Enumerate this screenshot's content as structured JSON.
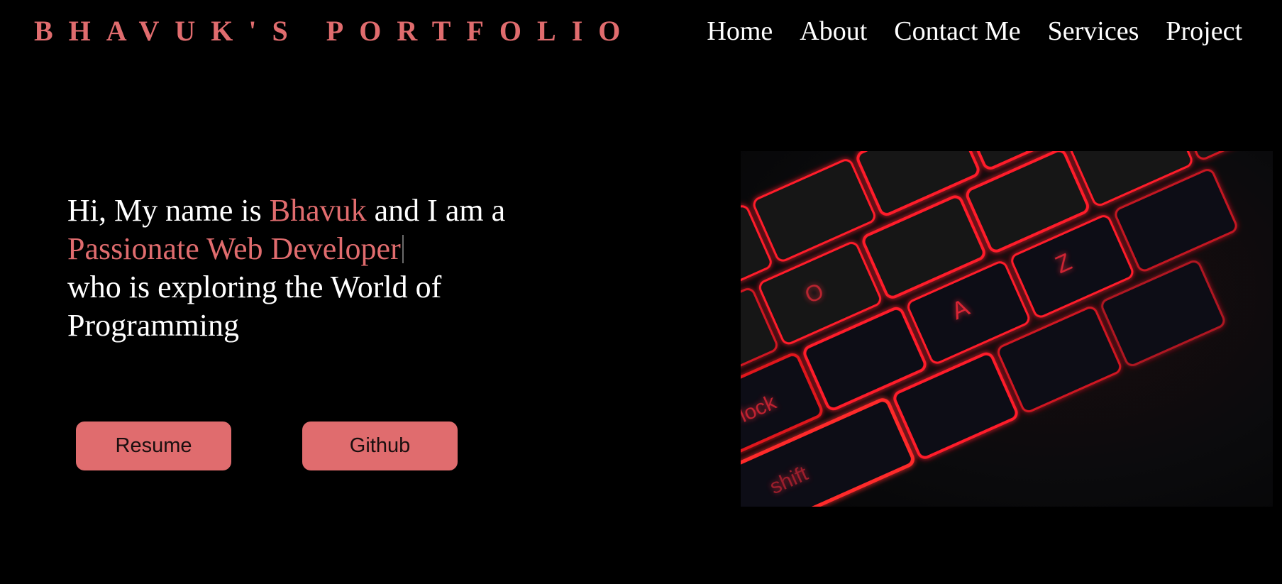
{
  "header": {
    "brand": "BHAVUK'S PORTFOLIO",
    "nav": [
      {
        "label": "Home"
      },
      {
        "label": "About"
      },
      {
        "label": "Contact Me"
      },
      {
        "label": "Services"
      },
      {
        "label": "Project"
      }
    ]
  },
  "hero": {
    "intro_prefix": "Hi, My name is ",
    "name": "Bhavuk",
    "intro_suffix": " and I am a",
    "role": "Passionate Web Developer",
    "line3": "who is exploring the World of",
    "line4": "Programming"
  },
  "buttons": {
    "resume": "Resume",
    "github": "Github"
  },
  "image": {
    "keycaps": [
      "A",
      "Z",
      "O",
      "caps lock",
      "shift"
    ]
  },
  "colors": {
    "accent": "#e06c6e",
    "background": "#000000",
    "text": "#ffffff",
    "glow": "#ff1a2a"
  }
}
